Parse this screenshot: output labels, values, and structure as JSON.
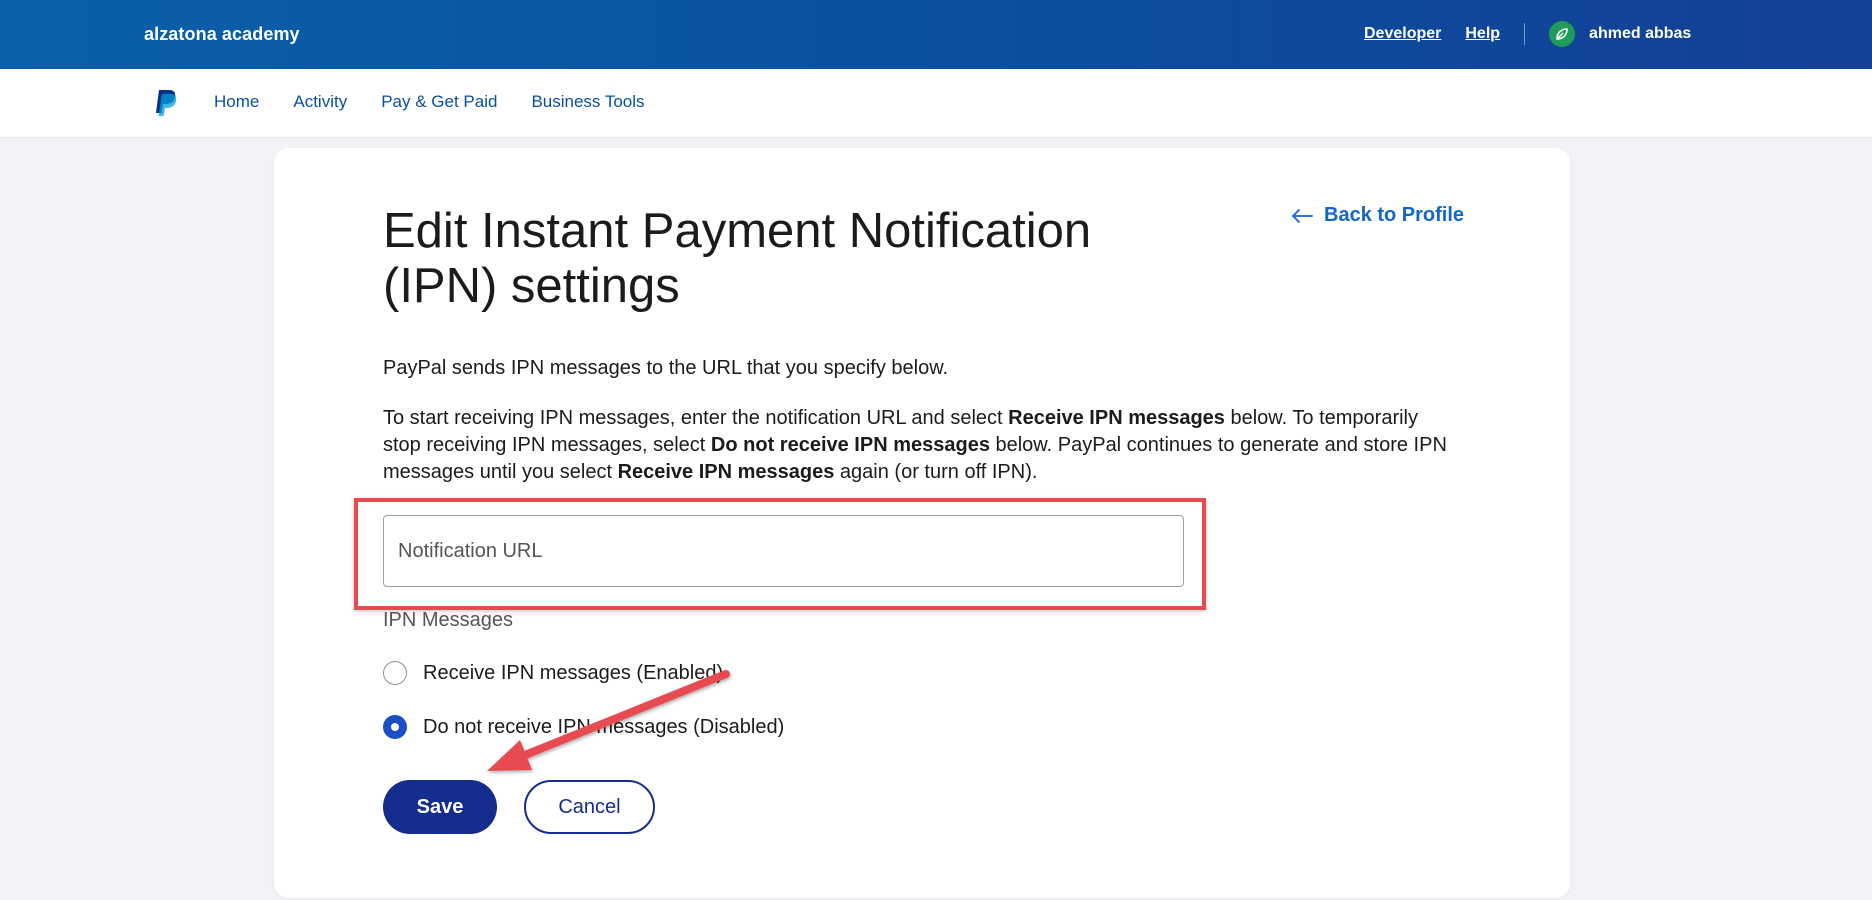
{
  "topbar": {
    "brand": "alzatona academy",
    "links": [
      "Developer",
      "Help"
    ],
    "user_name": "ahmed abbas",
    "background_color": "#0a4f9e"
  },
  "nav": {
    "logo_icon": "paypal-logo-icon",
    "items": [
      "Home",
      "Activity",
      "Pay & Get Paid",
      "Business Tools"
    ]
  },
  "page": {
    "title": "Edit Instant Payment Notification (IPN) settings",
    "back_link": "Back to Profile",
    "intro": "PayPal sends IPN messages to the URL that you specify below.",
    "desc": {
      "part1": "To start receiving IPN messages, enter the notification URL and select ",
      "bold1": "Receive IPN messages",
      "part2": " below. To temporarily stop receiving IPN messages, select ",
      "bold2": "Do not receive IPN messages",
      "part3": " below. PayPal continues to generate and store IPN messages until you select ",
      "bold3": "Receive IPN messages",
      "part4": " again (or turn off IPN)."
    }
  },
  "form": {
    "url_placeholder": "Notification URL",
    "url_value": "",
    "section_label": "IPN Messages",
    "options": [
      {
        "label": "Receive IPN messages (Enabled)",
        "selected": false
      },
      {
        "label": "Do not receive IPN messages (Disabled)",
        "selected": true
      }
    ],
    "save_label": "Save",
    "cancel_label": "Cancel"
  },
  "annotations": {
    "highlight_color": "#e84b4f"
  }
}
